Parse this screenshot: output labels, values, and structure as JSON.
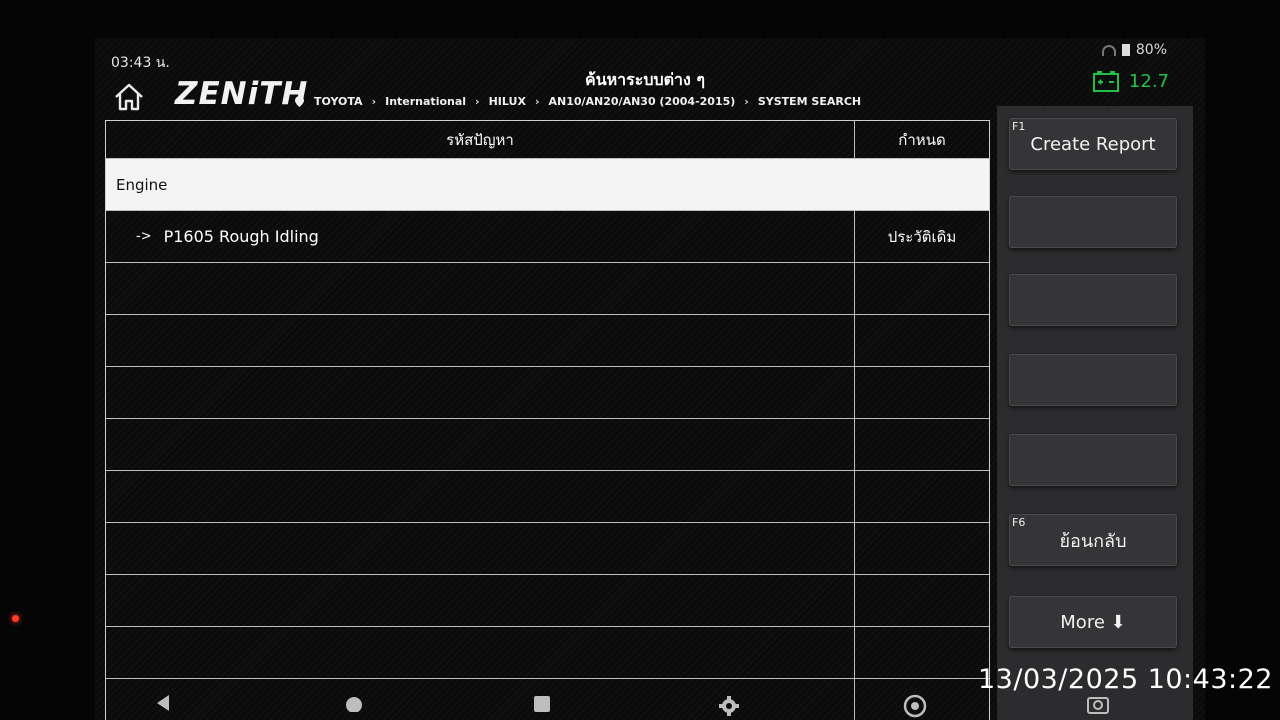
{
  "status": {
    "time": "03:43 น.",
    "battery_pct": "80%"
  },
  "header": {
    "logo": "ZENiTH",
    "title": "ค้นหาระบบต่าง ๆ",
    "breadcrumb": [
      "TOYOTA",
      "International",
      "HILUX",
      "AN10/AN20/AN30 (2004-2015)",
      "SYSTEM SEARCH"
    ],
    "voltage": "12.7",
    "voltage_color": "#22c04a"
  },
  "table": {
    "col_code": "รหัสปัญหา",
    "col_set": "กำหนด",
    "section": "Engine",
    "dtc_arrow": "->",
    "dtc_code": "P1605 Rough Idling",
    "dtc_status": "ประวัติเดิม"
  },
  "side_buttons": {
    "f1_key": "F1",
    "f1_label": "Create Report",
    "f6_key": "F6",
    "f6_label": "ย้อนกลับ",
    "more_label": "More ⬇"
  },
  "timestamp": "13/03/2025 10:43:22"
}
